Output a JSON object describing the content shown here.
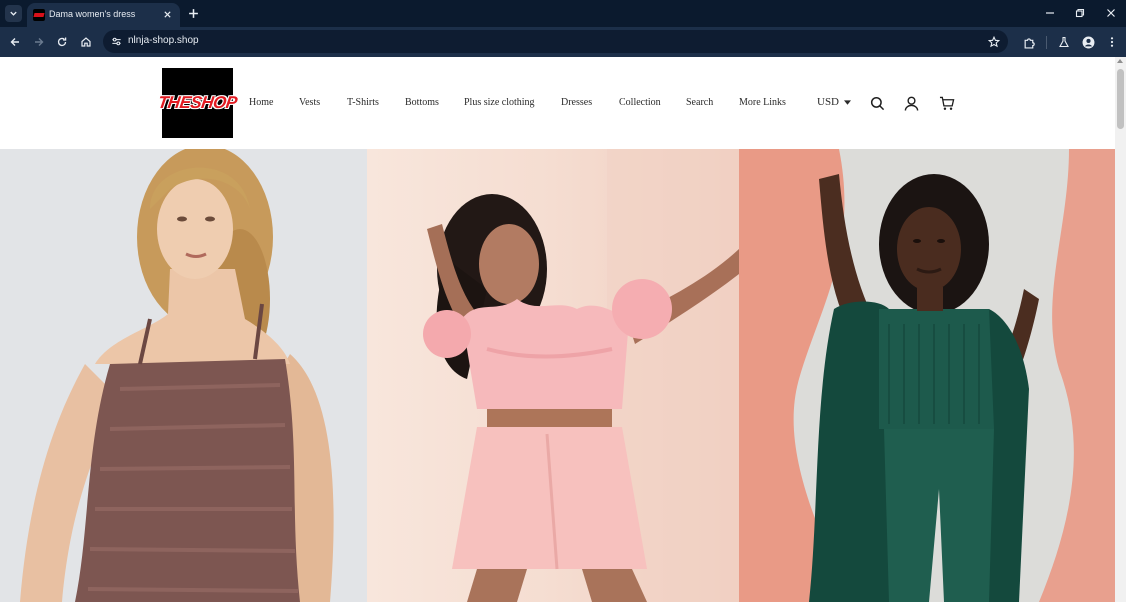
{
  "browser": {
    "tab_title": "Dama women's dress",
    "url": "nlnja-shop.shop"
  },
  "header": {
    "logo_text": "THESHOP",
    "nav": [
      "Home",
      "Vests",
      "T-Shirts",
      "Bottoms",
      "Plus size clothing",
      "Dresses",
      "Collection",
      "Search",
      "More Links"
    ],
    "currency": "USD"
  },
  "hero": {
    "panels": [
      "model-brown-knit-dress",
      "model-pink-ruffle-set",
      "model-green-knit-set"
    ]
  },
  "colors": {
    "chrome_dark": "#0b1a2e",
    "chrome_toolbar": "#1c2f49",
    "logo_bg": "#000000",
    "logo_red": "#e21b22",
    "pink_panel": "#f4dccf",
    "salmon_panel": "#e99985",
    "green_outfit": "#1d5a4c"
  }
}
